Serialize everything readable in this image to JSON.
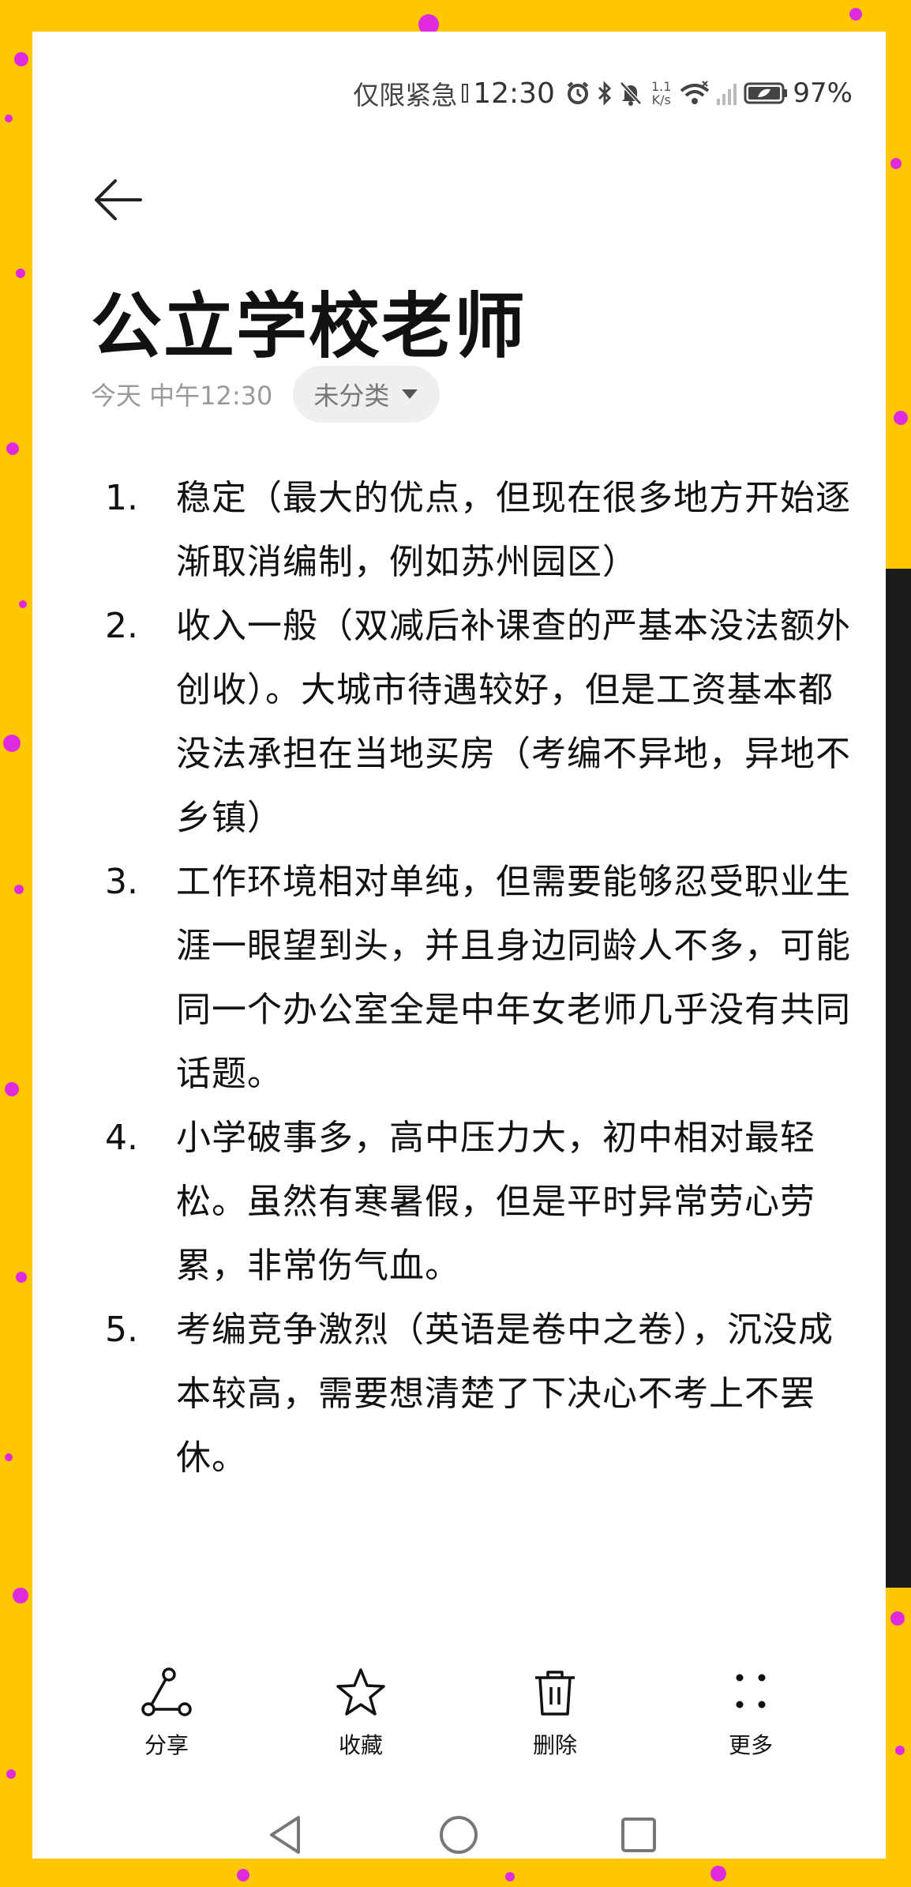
{
  "status_bar": {
    "carrier_text": "仅限紧急",
    "time": "12:30",
    "net_speed_value": "1.1",
    "net_speed_unit": "K/s",
    "battery_percent": "97%"
  },
  "note": {
    "title": "公立学校老师",
    "date": "今天 中午12:30",
    "category": "未分类",
    "items": [
      {
        "num": "1.",
        "text": "稳定（最大的优点，但现在很多地方开始逐渐取消编制，例如苏州园区）"
      },
      {
        "num": "2.",
        "text": "收入一般（双减后补课查的严基本没法额外创收）。大城市待遇较好，但是工资基本都没法承担在当地买房（考编不异地，异地不乡镇）"
      },
      {
        "num": "3.",
        "text": "工作环境相对单纯，但需要能够忍受职业生涯一眼望到头，并且身边同龄人不多，可能同一个办公室全是中年女老师几乎没有共同话题。"
      },
      {
        "num": "4.",
        "text": "小学破事多，高中压力大，初中相对最轻松。虽然有寒暑假，但是平时异常劳心劳累，非常伤气血。"
      },
      {
        "num": "5.",
        "text": "考编竞争激烈（英语是卷中之卷），沉没成本较高，需要想清楚了下决心不考上不罢休。"
      }
    ]
  },
  "toolbar": {
    "share_label": "分享",
    "favorite_label": "收藏",
    "delete_label": "删除",
    "more_label": "更多"
  },
  "icons": {
    "back": "arrow-left-icon",
    "share": "share-nodes-icon",
    "favorite": "star-icon",
    "delete": "trash-icon",
    "more": "four-dots-icon",
    "nav_back": "triangle-back-icon",
    "nav_home": "circle-home-icon",
    "nav_recent": "square-recent-icon"
  },
  "colors": {
    "frame_background": "#ffc700",
    "frame_dots": "#e02adf",
    "page_background": "#ffffff",
    "text": "#111111",
    "muted_text": "#999999"
  }
}
